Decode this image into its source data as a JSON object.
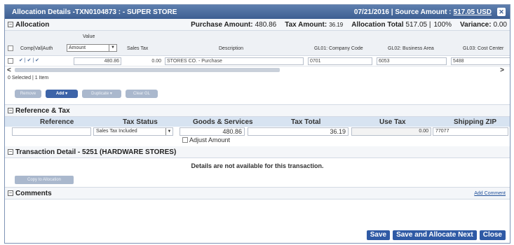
{
  "window": {
    "title": "Allocation Details -TXN0104873 : - SUPER STORE",
    "header_right": "07/21/2016 | Source Amount :",
    "source_amount": "517.05 USD",
    "close_icon": "close-icon"
  },
  "allocation": {
    "title": "Allocation",
    "purchase_label": "Purchase Amount:",
    "purchase_value": "480.86",
    "tax_label": "Tax Amount:",
    "tax_value": "36.19",
    "alloc_total_label": "Allocation Total",
    "alloc_total_value": "517.05 |",
    "alloc_pct": "100%",
    "variance_label": "Variance:",
    "variance_value": "0.00",
    "columns": {
      "comp": "Comp|Val|Auth",
      "value": "Value",
      "value_select": "Amount",
      "sales_tax": "Sales Tax",
      "description": "Description",
      "gl01": "GL01: Company Code",
      "gl02": "GL02: Business Area",
      "gl03": "GL03: Cost Center"
    },
    "row": {
      "ticks": "✔ | ✔ | ✔",
      "value": "480.86",
      "sales_tax": "0.00",
      "description": "STORES CO. - Purchase",
      "gl01": "0701",
      "gl02": "6053",
      "gl03": "5488"
    },
    "selected_info": "0 Selected | 1 Item",
    "buttons": {
      "remove": "Remove",
      "add": "Add ▾",
      "duplicate": "Duplicate ▾",
      "clear_gl": "Clear GL"
    }
  },
  "reference_tax": {
    "title": "Reference & Tax",
    "headers": {
      "reference": "Reference",
      "tax_status": "Tax Status",
      "goods": "Goods & Services",
      "tax_total": "Tax Total",
      "use_tax": "Use Tax",
      "shipping_zip": "Shipping ZIP"
    },
    "values": {
      "reference": "",
      "tax_status": "Sales Tax Included",
      "goods": "480.86",
      "tax_total": "36.19",
      "use_tax": "0.00",
      "shipping_zip": "77077"
    },
    "adjust_amount": "Adjust Amount"
  },
  "transaction_detail": {
    "title": "Transaction Detail - 5251 (HARDWARE STORES)",
    "message": "Details are not available for this transaction.",
    "copy_button": "Copy to Allocation"
  },
  "comments": {
    "title": "Comments",
    "add_comment": "Add Comment"
  },
  "footer": {
    "save": "Save",
    "save_next": "Save and Allocate Next",
    "close": "Close"
  }
}
